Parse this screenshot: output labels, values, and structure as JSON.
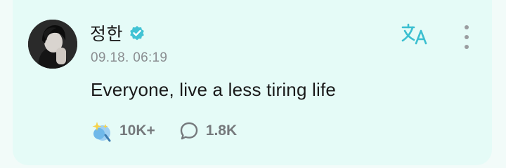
{
  "post": {
    "author": "정한",
    "verified": true,
    "timestamp": "09.18. 06:19",
    "message": "Everyone, live a less tiring life"
  },
  "actions": {
    "reactions_count": "10K+",
    "comments_count": "1.8K"
  },
  "icons": {
    "verified": "verified-badge-icon",
    "translate": "translate-icon",
    "more": "more-vertical-icon",
    "reaction": "sparkle-reaction-icon",
    "comment": "comment-bubble-icon"
  },
  "colors": {
    "card_background": "#e5fbf7",
    "accent": "#3bbfd0",
    "muted_text": "#8a8d90"
  }
}
